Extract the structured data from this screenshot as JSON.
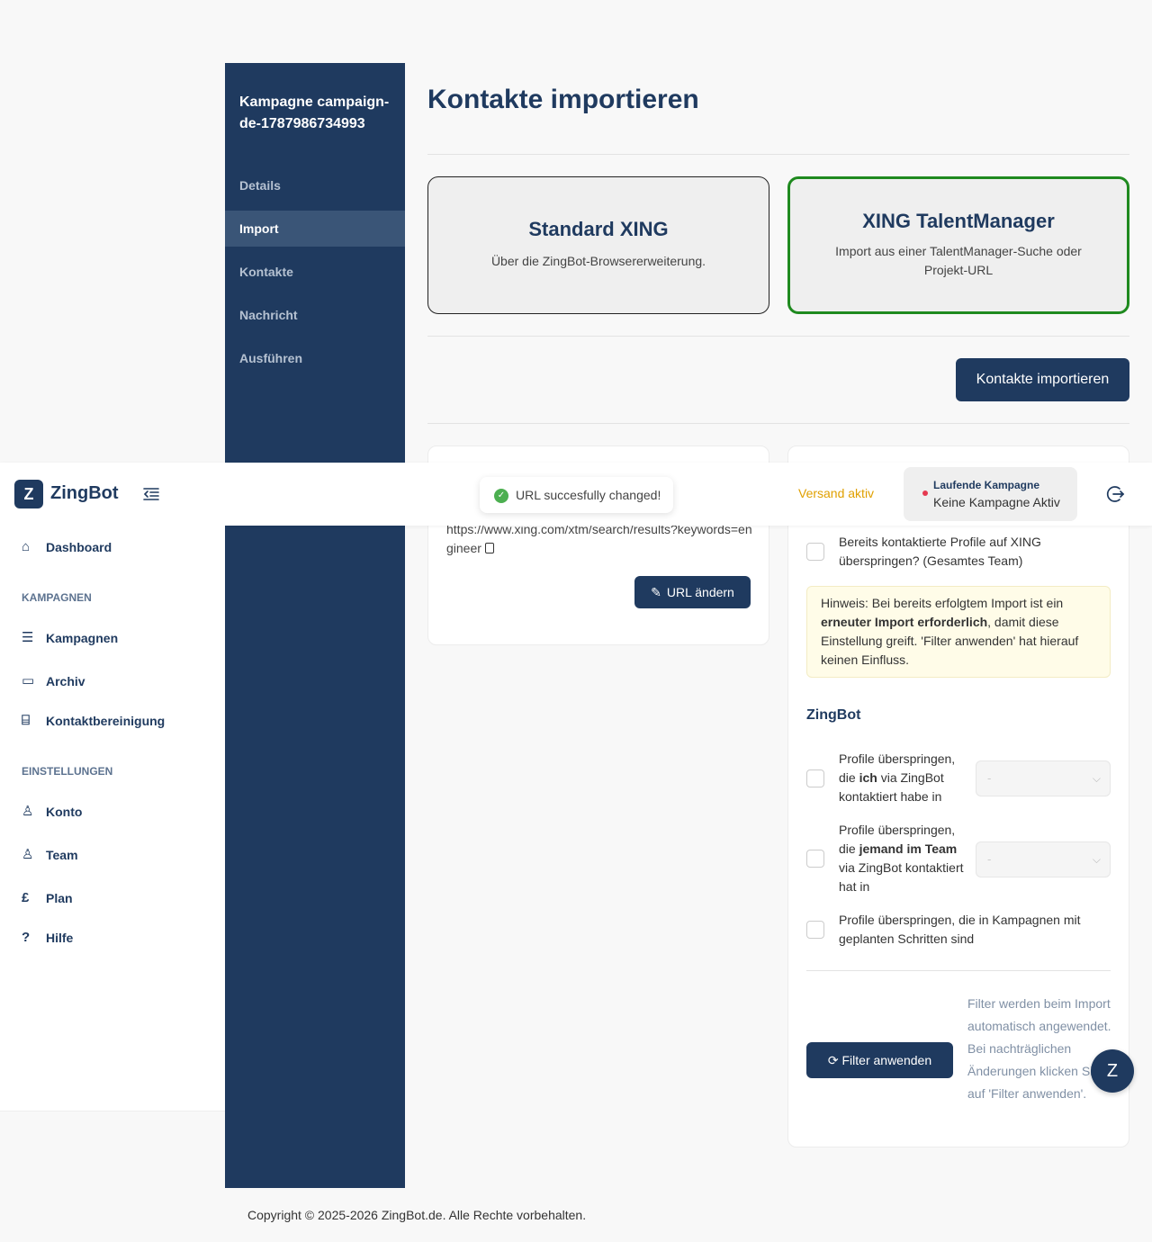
{
  "campaign": {
    "title": "Kampagne campaign-de-1787986734993",
    "nav": [
      "Details",
      "Import",
      "Kontakte",
      "Nachricht",
      "Ausführen"
    ],
    "active": "Import"
  },
  "main": {
    "title": "Kontakte importieren",
    "options": {
      "standard": {
        "title": "Standard XING",
        "desc": "Über die ZingBot-Browsererweiterung."
      },
      "talent": {
        "title": "XING TalentManager",
        "desc": "Import aus einer TalentManager-Suche oder Projekt-URL"
      }
    },
    "import_button": "Kontakte importieren"
  },
  "url_panel": {
    "url": "https://www.xing.com/xtm/search/results?keywords=engineer",
    "button": "URL ändern"
  },
  "filters": {
    "xing_skip": "Bereits kontaktierte Profile auf XING überspringen? (Gesamtes Team)",
    "hint_pre": "Hinweis: Bei bereits erfolgtem Import ist ein ",
    "hint_bold": "erneuter Import erforderlich",
    "hint_post": ", damit diese Einstellung greift. 'Filter anwenden' hat hierauf keinen Einfluss.",
    "zingbot_heading": "ZingBot",
    "skip_me_pre": "Profile überspringen, die ",
    "skip_me_bold": "ich",
    "skip_me_post": " via ZingBot kontaktiert habe in",
    "skip_team_pre": "Profile überspringen, die ",
    "skip_team_bold": "jemand im Team",
    "skip_team_post": " via ZingBot kontaktiert hat in",
    "select_value": "-",
    "skip_planned": "Profile überspringen, die in Kampagnen mit geplanten Schritten sind",
    "apply_button": "Filter anwenden",
    "apply_note": "Filter werden beim Import automatisch angewendet. Bei nachträglichen Änderungen klicken Sie auf 'Filter anwenden'."
  },
  "header": {
    "logo_letter": "Z",
    "logo_text": "ZingBot",
    "toast": "URL succesfully changed!",
    "versand": "Versand aktiv",
    "running_label": "Laufende Kampagne",
    "running_value": "Keine Kampagne Aktiv"
  },
  "sidebar": {
    "dashboard": "Dashboard",
    "section_campaigns": "KAMPAGNEN",
    "kampagnen": "Kampagnen",
    "archiv": "Archiv",
    "kontaktbereinigung": "Kontaktbereinigung",
    "section_settings": "EINSTELLUNGEN",
    "konto": "Konto",
    "team": "Team",
    "plan": "Plan",
    "hilfe": "Hilfe"
  },
  "footer": "Copyright © 2025-2026 ZingBot.de. Alle Rechte vorbehalten.",
  "fab_letter": "Z",
  "colors": {
    "primary": "#1f3a5f",
    "active_border": "#1f8a1f",
    "warning": "#e0a000",
    "success": "#4caf50"
  }
}
